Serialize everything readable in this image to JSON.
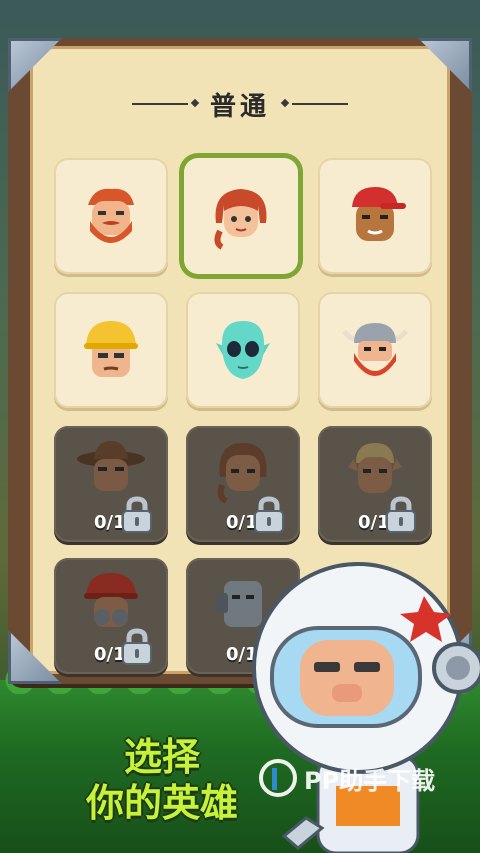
{
  "section": {
    "title": "普通"
  },
  "heroes": [
    {
      "name": "red-bearded-hero",
      "locked": false,
      "selected": false,
      "progress": ""
    },
    {
      "name": "redhead-hero",
      "locked": false,
      "selected": true,
      "progress": ""
    },
    {
      "name": "baseball-cap-hero",
      "locked": false,
      "selected": false,
      "progress": ""
    },
    {
      "name": "construction-helmet-hero",
      "locked": false,
      "selected": false,
      "progress": ""
    },
    {
      "name": "alien-hero",
      "locked": false,
      "selected": false,
      "progress": ""
    },
    {
      "name": "viking-hero",
      "locked": false,
      "selected": false,
      "progress": ""
    },
    {
      "name": "cowboy-hero",
      "locked": true,
      "selected": false,
      "progress": "0/15"
    },
    {
      "name": "braided-girl-hero",
      "locked": true,
      "selected": false,
      "progress": "0/15"
    },
    {
      "name": "elf-archer-hero",
      "locked": true,
      "selected": false,
      "progress": "0/15"
    },
    {
      "name": "firefighter-hero",
      "locked": true,
      "selected": false,
      "progress": "0/15"
    },
    {
      "name": "robot-hero",
      "locked": true,
      "selected": false,
      "progress": "0/15"
    }
  ],
  "cta": {
    "line1": "选择",
    "line2": "你的英雄"
  },
  "watermark": {
    "text": "PP助手下载"
  },
  "colors": {
    "selected_border": "#7fa534",
    "cta_text": "#c6f23a",
    "panel_bg": "#f2e3b6",
    "locked_card": "#5a5349"
  }
}
